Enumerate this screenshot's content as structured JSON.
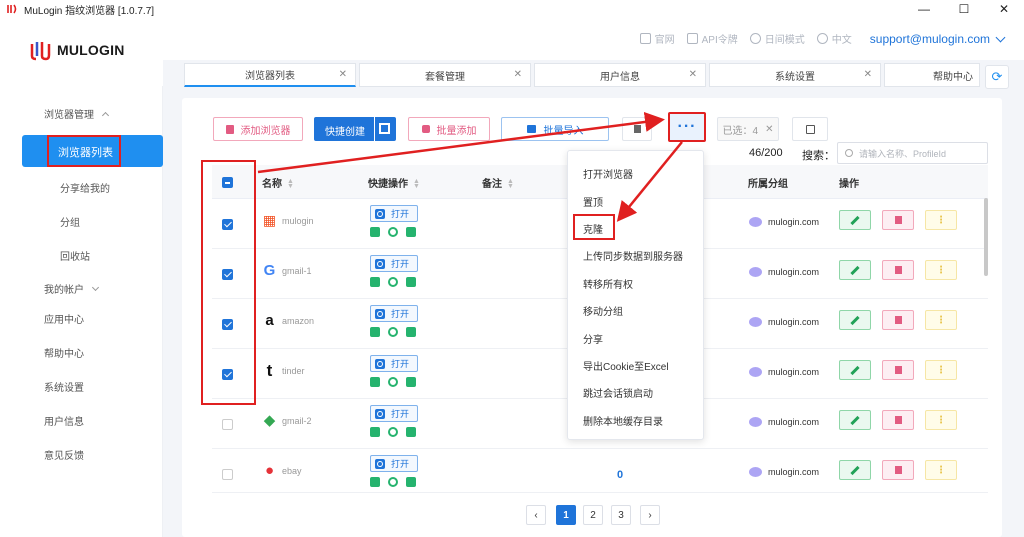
{
  "window": {
    "title": "MuLogin 指纹浏览器 [1.0.7.7]",
    "min": "—",
    "max": "☐",
    "close": "✕"
  },
  "brand": {
    "name": "MULOGIN"
  },
  "topnav": {
    "home": "官网",
    "api": "API令牌",
    "night": "日间模式",
    "lang": "中文",
    "email": "support@mulogin.com"
  },
  "sidebar": {
    "group1": "浏览器管理",
    "items": [
      "浏览器列表",
      "分享给我的",
      "分组",
      "回收站"
    ],
    "account": "我的帐户",
    "others": [
      "应用中心",
      "帮助中心",
      "系统设置",
      "用户信息",
      "意见反馈"
    ]
  },
  "tabs": [
    {
      "label": "浏览器列表",
      "close": "✕"
    },
    {
      "label": "套餐管理",
      "close": "✕"
    },
    {
      "label": "用户信息",
      "close": "✕"
    },
    {
      "label": "系统设置",
      "close": "✕"
    },
    {
      "label": "帮助中心",
      "close": ""
    }
  ],
  "toolbar": {
    "add": "添加浏览器",
    "quick": "快捷创建",
    "batch": "批量添加",
    "import": "批量导入",
    "more": "···",
    "selected": "已选：4",
    "selected_close": "✕"
  },
  "count": "46/200",
  "search": {
    "label": "搜索：",
    "placeholder": "请输入名称、ProfileId"
  },
  "table": {
    "headers": {
      "name": "名称",
      "quick": "快捷操作",
      "note": "备注",
      "group": "所属分组",
      "actions": "操作"
    },
    "open_label": "打开",
    "rows": [
      {
        "name": "mulogin",
        "logo": "■",
        "logo_color": "#f25022",
        "group": "mulogin.com",
        "checked": true
      },
      {
        "name": "gmail-1",
        "logo": "G",
        "logo_color": "#4285f4",
        "group": "mulogin.com",
        "checked": true
      },
      {
        "name": "amazon",
        "logo": "a",
        "logo_color": "#111111",
        "group": "mulogin.com",
        "checked": true
      },
      {
        "name": "tinder",
        "logo": "t",
        "logo_color": "#111111",
        "group": "mulogin.com",
        "checked": true
      },
      {
        "name": "gmail-2",
        "logo": "◆",
        "logo_color": "#34a853",
        "group": "mulogin.com",
        "checked": false
      },
      {
        "name": "ebay",
        "logo": "●",
        "logo_color": "#e53238",
        "group": "mulogin.com",
        "checked": false
      }
    ],
    "zero_value": "0"
  },
  "more_menu": {
    "items": [
      "打开浏览器",
      "置顶",
      "克隆",
      "上传同步数据到服务器",
      "转移所有权",
      "移动分组",
      "分享",
      "导出Cookie至Excel",
      "跳过会话锁启动",
      "删除本地缓存目录"
    ]
  },
  "pagination": {
    "prev": "‹",
    "pages": [
      "1",
      "2",
      "3"
    ],
    "next": "›",
    "current": "1"
  },
  "colors": {
    "primary": "#1f74d9",
    "annotation": "#e02020"
  }
}
